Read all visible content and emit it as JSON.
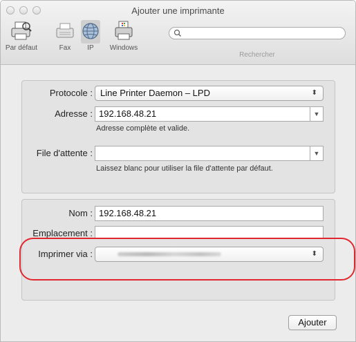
{
  "window": {
    "title": "Ajouter une imprimante",
    "accent_color": "#e0262e"
  },
  "toolbar": {
    "items": [
      {
        "label": "Par défaut",
        "icon": "default-printer-icon",
        "selected": false
      },
      {
        "label": "Fax",
        "icon": "fax-icon",
        "selected": false
      },
      {
        "label": "IP",
        "icon": "ip-globe-icon",
        "selected": true
      },
      {
        "label": "Windows",
        "icon": "windows-printer-icon",
        "selected": false
      }
    ],
    "search": {
      "value": "",
      "label": "Rechercher",
      "icon": "search-icon"
    }
  },
  "connection": {
    "protocol": {
      "label": "Protocole :",
      "value": "Line Printer Daemon – LPD"
    },
    "address": {
      "label": "Adresse :",
      "value": "192.168.48.21",
      "hint": "Adresse complète et valide."
    },
    "queue": {
      "label": "File d'attente :",
      "value": "",
      "hint": "Laissez blanc pour utiliser la file d'attente par défaut."
    }
  },
  "printer_info": {
    "name": {
      "label": "Nom :",
      "value": "192.168.48.21"
    },
    "location": {
      "label": "Emplacement :",
      "value": ""
    },
    "driver": {
      "label": "Imprimer via :",
      "value": ""
    }
  },
  "footer": {
    "add_label": "Ajouter"
  }
}
